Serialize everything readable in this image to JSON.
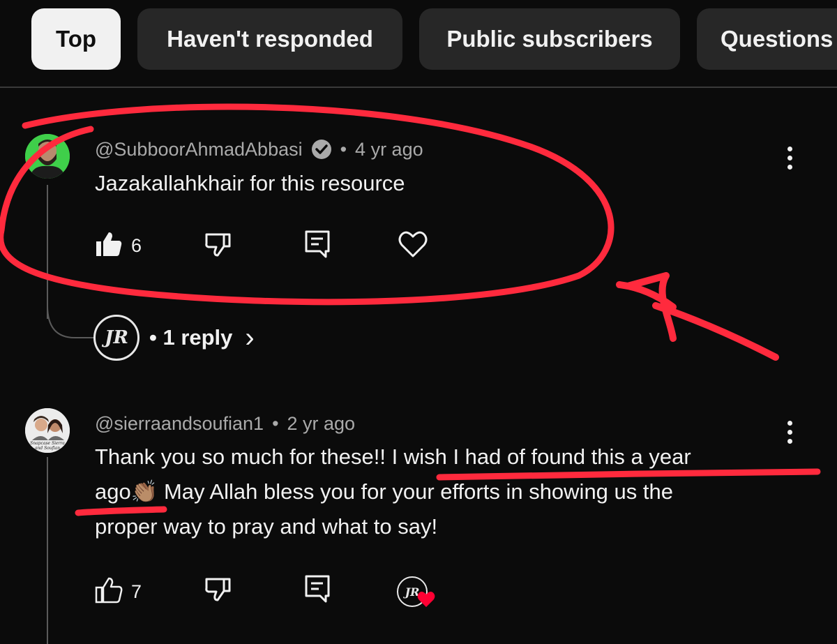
{
  "chips": [
    {
      "label": "Top",
      "active": true
    },
    {
      "label": "Haven't responded",
      "active": false
    },
    {
      "label": "Public subscribers",
      "active": false
    },
    {
      "label": "Questions",
      "active": false
    }
  ],
  "comments": [
    {
      "handle": "@SubboorAhmadAbbasi",
      "verified": true,
      "separator": "•",
      "time": "4 yr ago",
      "text": "Jazakallahkhair for this resource",
      "likes": "6",
      "liked": true,
      "replies_label": "• 1 reply",
      "replies_chevron": "›"
    },
    {
      "handle": "@sierraandsoufian1",
      "separator": "•",
      "time": "2 yr ago",
      "text_line1": "Thank you so much for these!! I wish I had of found this a year",
      "text_line2_a": "ago",
      "text_line2_emoji": "👏🏽",
      "text_line2_b": " May Allah bless you for your efforts in showing us the",
      "text_line3": "proper way to pray and what to say!",
      "likes": "7",
      "liked": false,
      "hearted_by_creator": true
    }
  ],
  "avatar2_caption": "Snapcase Sierra and Soufian",
  "logo_text": "JR",
  "colors": {
    "background": "#0b0b0b",
    "annotation": "#ff2a3d",
    "heart": "#ff0033",
    "chip": "#272727"
  }
}
